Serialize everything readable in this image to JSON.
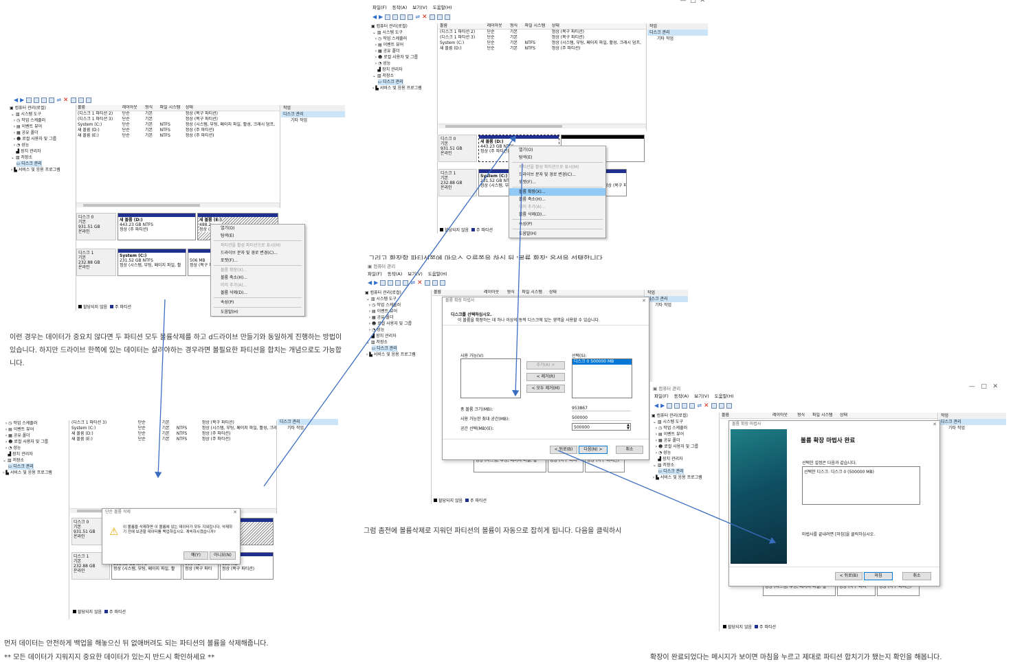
{
  "menu": [
    "파일(F)",
    "동작(A)",
    "보기(V)",
    "도움말(H)"
  ],
  "window_title": "컴퓨터 관리",
  "tree": {
    "root": "컴퓨터 관리(로컬)",
    "system_tools": "시스템 도구",
    "task_scheduler": "작업 스케줄러",
    "event_viewer": "이벤트 뷰어",
    "shared_folders": "공유 폴더",
    "local_users": "로컬 사용자 및 그룹",
    "performance": "성능",
    "device_manager": "장치 관리자",
    "storage": "저장소",
    "disk_management": "디스크 관리",
    "services": "서비스 및 응용 프로그램"
  },
  "volume_columns": [
    "볼륨",
    "레이아웃",
    "형식",
    "파일 시스템",
    "상태"
  ],
  "volumes": [
    {
      "name": "(디스크 1 파티션 2)",
      "layout": "단순",
      "type": "기본",
      "fs": "",
      "status": "정상 (복구 파티션)"
    },
    {
      "name": "(디스크 1 파티션 3)",
      "layout": "단순",
      "type": "기본",
      "fs": "",
      "status": "정상 (복구 파티션)"
    },
    {
      "name": "System (C:)",
      "layout": "단순",
      "type": "기본",
      "fs": "NTFS",
      "status": "정상 (시스템, 부팅, 페이지 파일, 활성, 크래시 덤프,"
    },
    {
      "name": "새 볼륨 (D:)",
      "layout": "단순",
      "type": "기본",
      "fs": "NTFS",
      "status": "정상 (주 파티션)"
    },
    {
      "name": "새 볼륨 (E:)",
      "layout": "단순",
      "type": "기본",
      "fs": "NTFS",
      "status": "정상 (주 파티션)"
    }
  ],
  "actions": {
    "header": "작업",
    "selected": "디스크 관리",
    "more": "기타 작업"
  },
  "disk0": {
    "name": "디스크 0",
    "type": "기본",
    "size": "931.51 GB",
    "state": "온라인"
  },
  "disk1": {
    "name": "디스크 1",
    "type": "기본",
    "size": "232.88 GB",
    "state": "온라인"
  },
  "partD": {
    "name": "새 볼륨 (D:)",
    "size": "443.23 GB NTFS",
    "status": "정상 (주 파티션)"
  },
  "partE": {
    "name": "새 볼륨 (E:)",
    "size": "488.2",
    "status": "정상 (주"
  },
  "partC": {
    "name": "System (C:)",
    "size": "231.52 GB NTFS",
    "status": "정상 (시스템, 부팅, 페이지 파일, 활"
  },
  "part506": {
    "size": "506 MB",
    "status": "정상 (복구 파티"
  },
  "part885": {
    "size": "885 MB",
    "status": "정상 (복구 파티션)"
  },
  "legend": {
    "unallocated": "할당되지 않음",
    "primary": "주 파티션"
  },
  "context_menu": [
    "열기(O)",
    "탐색(E)",
    "파티션을 활성 파티션으로 표시(M)",
    "드라이브 문자 및 경로 변경(C)...",
    "포맷(F)...",
    "볼륨 확장(X)...",
    "볼륨 축소(H)...",
    "미러 추가(A)...",
    "볼륨 삭제(D)...",
    "속성(P)",
    "도움말(H)"
  ],
  "text1": "이런 경우는 데이터가 중요치 않다면 두 파티션 모두 볼륨삭제를 하고 d드라이브 만들기와 동일하게 진행하는 방법이 있습니다. 하지만 드라이브 한쪽에 있는 데이터는 살려야하는 경우라면 볼필요한 파티션을 합치는 개념으로도 가능합니다.",
  "text2_line1": "먼저 데이터는 안전하게 백업을 해놓으신 뒤 없애버려도 되는 파티션의 볼륨을 삭제해줍니다.",
  "text2_line2": "** 모든 데이터가 지워지지 중요한 데이터가 있는지 반드시 확인하세요 **",
  "text3": "그리고 확장할 파티션쪽에 마우스 오른쪽을 하신 뒤 '볼륨 확장' 옵션을 선택합니다.",
  "text4": "그럼 좀전에 볼륨삭제로 지워던 파티션의 볼륨이 자동으로 잡히게 됩니다. 다음을 클릭하시",
  "text5": "확장이 완료되었다는 메시지가 보이면 마침을 누르고 제대로 파티션 합치기가 됐는지 확인을 해봅니다.",
  "delete_dialog": {
    "title": "단순 볼륨 삭제",
    "message": "이 볼륨을 삭제하면 이 볼륨에 있는 데이터가 모두 지워집니다. 삭제하기 전에 보관할 데이터를 백업하십시오. 계속하시겠습니까?",
    "yes": "예(Y)",
    "no": "아니요(N)"
  },
  "wizard": {
    "title": "볼륨 확장 마법사",
    "heading": "디스크를 선택하십시오.",
    "sub": "이 볼륨을 확장하는 데 하나 이상의 동적 디스크에 있는 영역을 사용할 수 있습니다.",
    "available": "사용 가능(V):",
    "selected": "선택(S):",
    "selected_item": "디스크 0    500000 MB",
    "add": "추가(A) >",
    "remove": "< 제거(R)",
    "remove_all": "< 모두 제거(M)",
    "total_label": "총 볼륨 크기(MB):",
    "total_value": "953867",
    "max_label": "사용 가능한 최대 공간(MB):",
    "max_value": "500000",
    "space_label": "공간 선택(MB)(E):",
    "space_value": "500000",
    "back": "< 뒤로(B)",
    "next": "다음(N) >",
    "cancel": "취소"
  },
  "finish": {
    "title": "볼륨 확장 마법사",
    "heading": "볼륨 확장 마법사 완료",
    "settings": "선택한 설정은 다음과 같습니다.",
    "selected_disk": "선택한 디스크: 디스크 0 (500000 MB)",
    "instruction": "마법사를 끝내려면 [마침]을 클릭하십시오.",
    "back": "< 뒤로(B)",
    "finish": "마침",
    "cancel": "취소"
  },
  "colors": {
    "primary_partition": "#1f2f90",
    "selection": "#cce4f7",
    "arrow": "#3a6cc0"
  }
}
